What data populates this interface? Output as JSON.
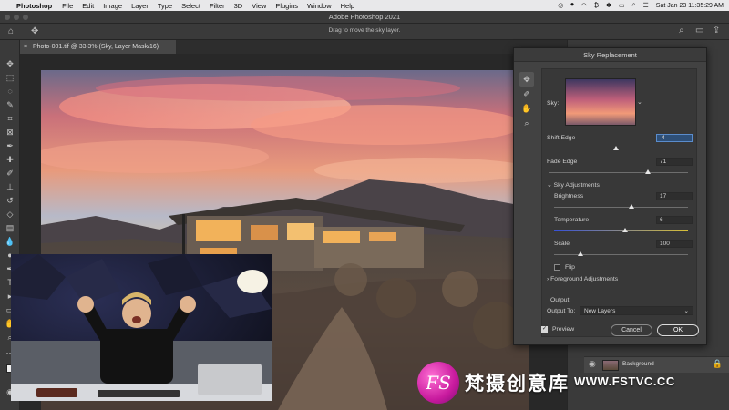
{
  "menubar": {
    "apple_icon": "apple-icon",
    "app_name": "Photoshop",
    "items": [
      "File",
      "Edit",
      "Image",
      "Layer",
      "Type",
      "Select",
      "Filter",
      "3D",
      "View",
      "Plugins",
      "Window",
      "Help"
    ],
    "clock": "Sat Jan 23  11:35:29 AM"
  },
  "app": {
    "title": "Adobe Photoshop 2021",
    "option_hint": "Drag to move the sky layer."
  },
  "document": {
    "tab_label": "Photo-001.tif @ 33.3% (Sky, Layer Mask/16)"
  },
  "dialog": {
    "title": "Sky Replacement",
    "sky_label": "Sky:",
    "shift_edge": {
      "label": "Shift Edge",
      "value": "-4",
      "level": 0.48
    },
    "fade_edge": {
      "label": "Fade Edge",
      "value": "71",
      "level": 0.71
    },
    "sky_adjustments_label": "Sky Adjustments",
    "brightness": {
      "label": "Brightness",
      "value": "17",
      "level": 0.58
    },
    "temperature": {
      "label": "Temperature",
      "value": "6",
      "level": 0.53
    },
    "scale": {
      "label": "Scale",
      "value": "100",
      "level": 0.2
    },
    "flip_label": "Flip",
    "foreground_label": "Foreground Adjustments",
    "output_heading": "Output",
    "output_to_label": "Output To:",
    "output_to_value": "New Layers",
    "preview_label": "Preview",
    "cancel_label": "Cancel",
    "ok_label": "OK"
  },
  "layers": {
    "background_name": "Background"
  },
  "watermark": {
    "logo_text": "FS",
    "cn_text": "梵摄创意库",
    "url": "WWW.FSTVC.CC"
  },
  "colors": {
    "accent": "#2e4f77",
    "panel": "#424242",
    "app_bg": "#323232",
    "watermark_magenta": "#c81a9e"
  }
}
